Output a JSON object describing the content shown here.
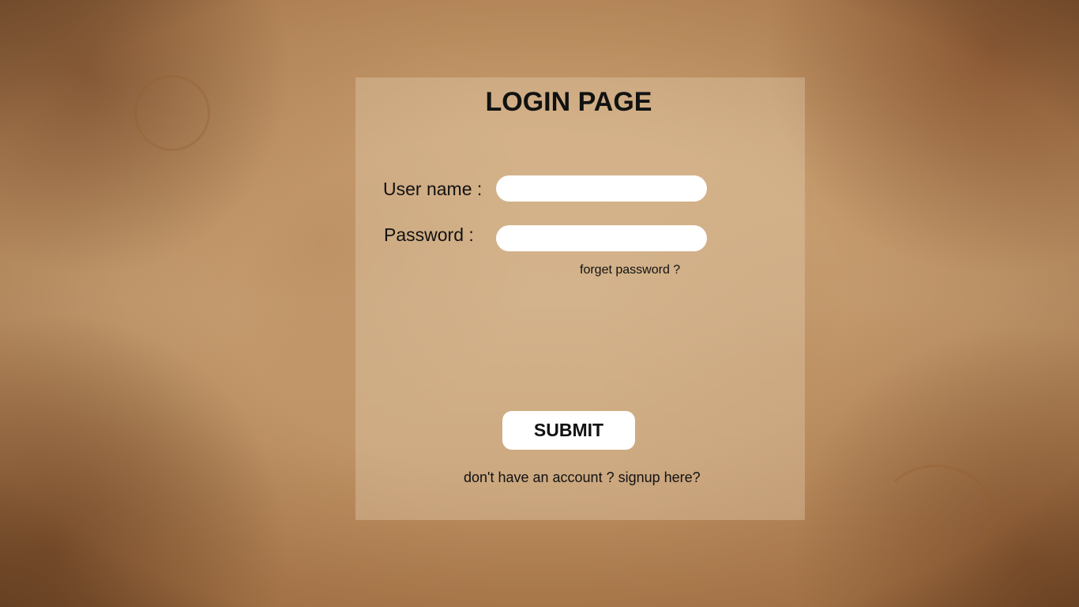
{
  "login": {
    "title": "LOGIN PAGE",
    "username_label": "User name :",
    "username_value": "",
    "password_label": "Password :",
    "password_value": "",
    "forgot_link": "forget password ?",
    "submit_label": "SUBMIT",
    "signup_link": "don't have an account ? signup here?"
  }
}
